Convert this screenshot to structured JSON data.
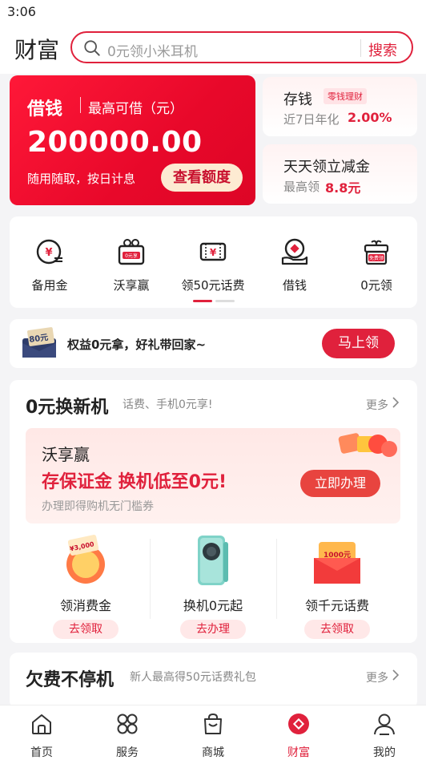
{
  "status": {
    "time": "3:06"
  },
  "header": {
    "title": "财富",
    "search_placeholder": "0元领小米耳机",
    "search_button": "搜索"
  },
  "loan_card": {
    "title": "借钱",
    "subtitle": "最高可借（元）",
    "amount": "200000.00",
    "desc": "随用随取，按日计息",
    "button": "查看额度"
  },
  "save_card": {
    "title": "存钱",
    "tag": "零钱理财",
    "label": "近7日年化",
    "value": "2.00%"
  },
  "discount_card": {
    "title": "天天领立减金",
    "label": "最高领",
    "value": "8.8元"
  },
  "quick_menu": {
    "items": [
      {
        "label": "备用金",
        "icon": "yen-coin-icon"
      },
      {
        "label": "沃享赢",
        "icon": "gift-box-icon"
      },
      {
        "label": "领50元话费",
        "icon": "yen-ticket-icon"
      },
      {
        "label": "借钱",
        "icon": "hand-coin-icon"
      },
      {
        "label": "0元领",
        "icon": "free-gift-icon"
      }
    ],
    "gift_badge": "0元享",
    "free_badge": "免费领"
  },
  "promo": {
    "envelope_amount": "80元",
    "text": "权益0元拿，好礼带回家~",
    "button": "马上领"
  },
  "trade_in": {
    "title": "0元换新机",
    "subtitle": "话费、手机0元享!",
    "more": "更多",
    "banner": {
      "brand": "沃享赢",
      "headline": "存保证金 换机低至0元!",
      "desc": "办理即得购机无门槛券",
      "button": "立即办理"
    },
    "offers": [
      {
        "label": "领消费金",
        "button": "去领取",
        "badge": "¥3,000"
      },
      {
        "label": "换机0元起",
        "button": "去办理"
      },
      {
        "label": "领千元话费",
        "button": "去领取",
        "badge": "1000元"
      }
    ]
  },
  "arrears": {
    "title": "欠费不停机",
    "subtitle": "新人最高得50元话费礼包",
    "more": "更多"
  },
  "tabbar": {
    "tabs": [
      {
        "label": "首页",
        "icon": "home-icon"
      },
      {
        "label": "服务",
        "icon": "grid-icon"
      },
      {
        "label": "商城",
        "icon": "shopping-bag-icon"
      },
      {
        "label": "财富",
        "icon": "wealth-icon",
        "active": true
      },
      {
        "label": "我的",
        "icon": "profile-icon"
      }
    ]
  },
  "colors": {
    "brand_red": "#e0213c",
    "accent_cream": "#fdebd2"
  }
}
